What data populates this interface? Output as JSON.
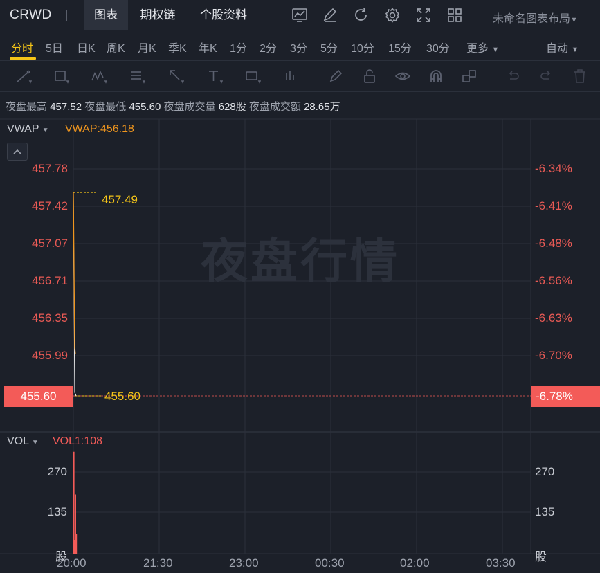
{
  "header": {
    "ticker": "CRWD",
    "tabs": [
      "图表",
      "期权链",
      "个股资料"
    ],
    "layout_name": "未命名图表布局"
  },
  "periods": {
    "items": [
      "分时",
      "5日",
      "日K",
      "周K",
      "月K",
      "季K",
      "年K",
      "1分",
      "2分",
      "3分",
      "5分",
      "10分",
      "15分",
      "30分",
      "更多"
    ],
    "active": "分时",
    "auto_label": "自动"
  },
  "stats": {
    "high_label": "夜盘最高",
    "high_value": "457.52",
    "low_label": "夜盘最低",
    "low_value": "455.60",
    "volume_label": "夜盘成交量",
    "volume_value": "628股",
    "turnover_label": "夜盘成交额",
    "turnover_value": "28.65万"
  },
  "main_chart": {
    "indicator_name": "VWAP",
    "indicator_value": "VWAP:456.18",
    "watermark": "夜盘行情",
    "high_marker": "457.49",
    "low_marker": "455.60",
    "current_price": "455.60",
    "current_pct": "-6.78%",
    "colors": {
      "price_line": "#ffffff",
      "vwap_line": "#f0961e",
      "marker": "#f5c518",
      "tick": "#e95a55",
      "highlight": "#f35b58"
    }
  },
  "vol_chart": {
    "indicator_name": "VOL",
    "indicator_value": "VOL1:108",
    "unit": "股"
  },
  "chart_data": {
    "type": "line",
    "price_ticks": [
      "457.78",
      "457.42",
      "457.07",
      "456.71",
      "456.35",
      "455.99"
    ],
    "pct_ticks": [
      "-6.34%",
      "-6.41%",
      "-6.48%",
      "-6.56%",
      "-6.63%",
      "-6.70%"
    ],
    "x_ticks": [
      "20:00",
      "21:30",
      "23:00",
      "00:30",
      "02:00",
      "03:30"
    ],
    "ylim": [
      455.6,
      457.78
    ],
    "series": [
      {
        "name": "VWAP",
        "x": [
          "20:00",
          "20:01"
        ],
        "values": [
          457.49,
          456.18
        ]
      }
    ],
    "price_values": [
      457.49,
      455.6
    ],
    "volume": {
      "ticks": [
        "270",
        "135"
      ],
      "ylim": [
        0,
        320
      ],
      "values": [
        310,
        40,
        180,
        60
      ]
    }
  }
}
